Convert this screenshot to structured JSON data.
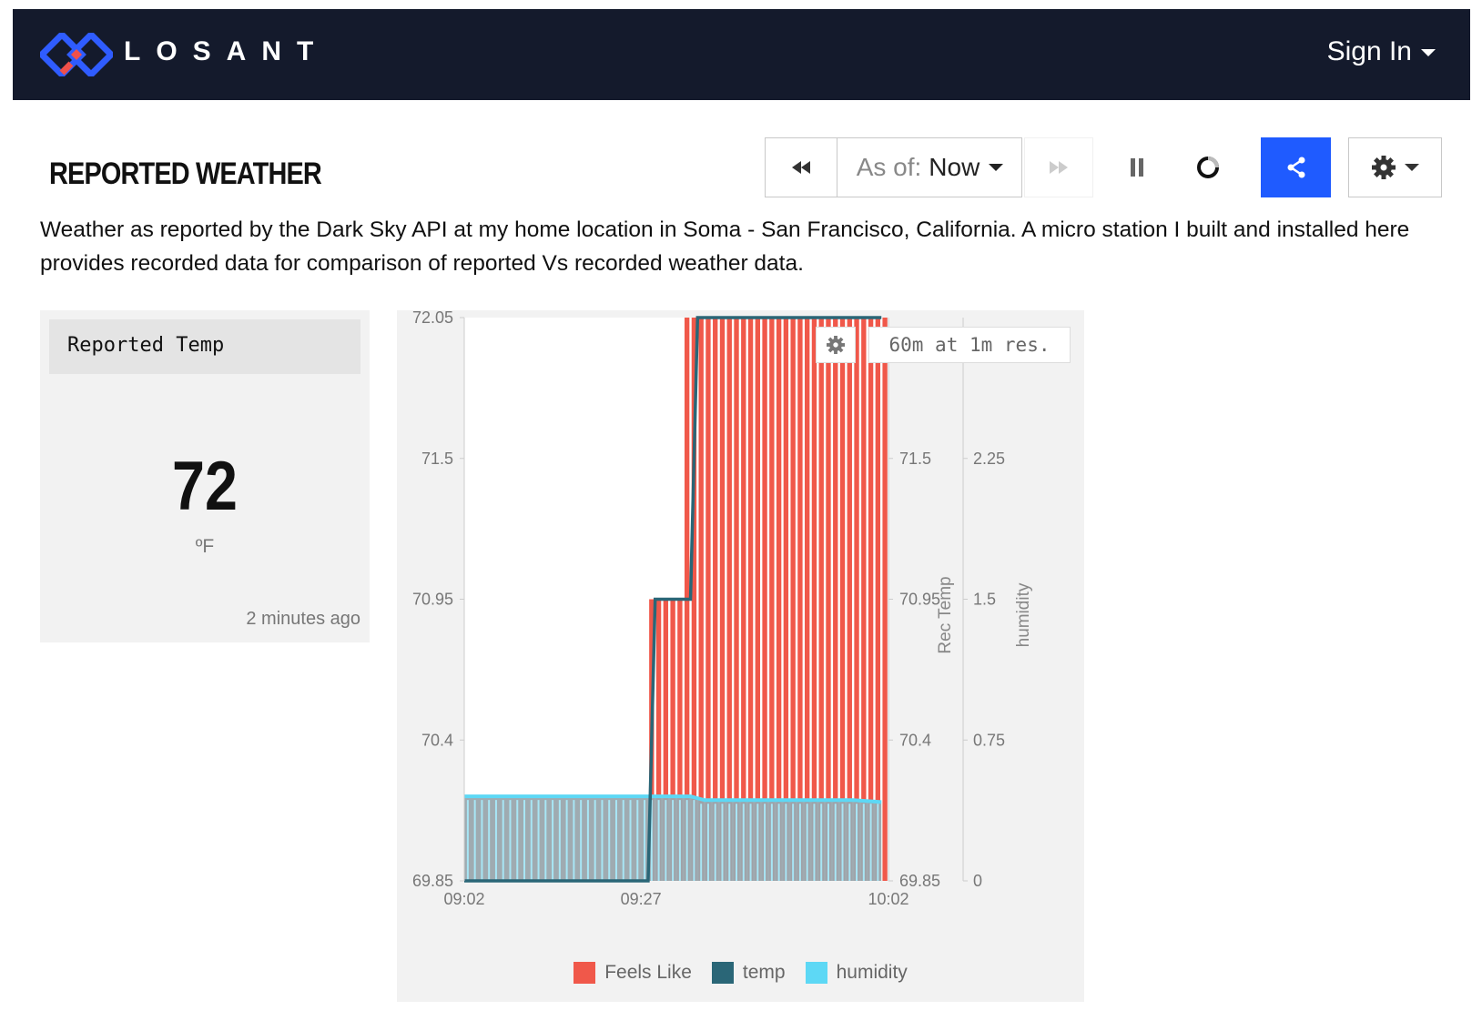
{
  "navbar": {
    "brand": "LOSANT",
    "signin_label": "Sign In",
    "colors": {
      "bg": "#141a2c",
      "logo_blue": "#2f5cff",
      "logo_red": "#f0504a"
    }
  },
  "dashboard": {
    "title": "REPORTED WEATHER",
    "description": "Weather as reported by the Dark Sky API at my home location in Soma - San Francisco, California. A micro station I built and installed here provides recorded data for comparison of reported Vs recorded weather data."
  },
  "toolbar": {
    "prev_icon": "rewind-icon",
    "asof_label": "As of:",
    "asof_value": "Now",
    "next_icon": "fast-forward-icon",
    "pause_icon": "pause-icon",
    "spinner_icon": "loading-spinner-icon",
    "share_icon": "share-icon",
    "settings_icon": "gear-icon",
    "share_color": "#1f5bff"
  },
  "indicator": {
    "header": "Reported Temp",
    "value": "72",
    "unit": "ºF",
    "updated": "2 minutes ago"
  },
  "chart_overlay": {
    "settings_icon": "gear-icon",
    "resolution_label": "60m at 1m res."
  },
  "chart_data": {
    "type": "bar",
    "x_tick_labels": [
      "09:02",
      "09:27",
      "10:02"
    ],
    "x_range_minutes": [
      0,
      60
    ],
    "y_left": {
      "ticks": [
        "72.05",
        "71.5",
        "70.95",
        "70.4",
        "69.85"
      ],
      "range": [
        69.85,
        72.05
      ]
    },
    "y_right_1": {
      "title": "Rec Temp",
      "ticks": [
        "71.5",
        "70.95",
        "70.4",
        "69.85"
      ],
      "range": [
        69.85,
        72.05
      ]
    },
    "y_right_2": {
      "title": "humidity",
      "ticks": [
        "2.25",
        "1.5",
        "0.75",
        "0"
      ],
      "range": [
        0,
        3
      ]
    },
    "series": [
      {
        "name": "Feels Like",
        "kind": "bar",
        "color": "#f0584a",
        "axis": "y_left",
        "values": [
          69.85,
          69.85,
          69.85,
          69.85,
          69.85,
          69.85,
          69.85,
          69.85,
          69.85,
          69.85,
          69.85,
          69.85,
          69.85,
          69.85,
          69.85,
          69.85,
          69.85,
          69.85,
          69.85,
          69.85,
          69.85,
          69.85,
          69.85,
          69.85,
          69.85,
          69.85,
          70.95,
          70.95,
          70.95,
          70.95,
          70.95,
          72.05,
          72.05,
          72.05,
          72.05,
          72.05,
          72.05,
          72.05,
          72.05,
          72.05,
          72.05,
          72.05,
          72.05,
          72.05,
          72.05,
          72.05,
          72.05,
          72.05,
          72.05,
          72.05,
          72.05,
          72.05,
          72.05,
          72.05,
          72.05,
          72.05,
          72.05,
          72.05,
          72.05,
          72.05
        ]
      },
      {
        "name": "temp",
        "kind": "line",
        "color": "#2a6677",
        "axis": "y_right_1",
        "points": [
          [
            0,
            69.85
          ],
          [
            26,
            69.85
          ],
          [
            27,
            70.95
          ],
          [
            32,
            70.95
          ],
          [
            33,
            72.05
          ],
          [
            59,
            72.05
          ]
        ]
      },
      {
        "name": "humidity",
        "kind": "area",
        "color": "#5dd8f5",
        "axis": "y_right_2",
        "points": [
          [
            0,
            0.45
          ],
          [
            26,
            0.45
          ],
          [
            32,
            0.45
          ],
          [
            34,
            0.43
          ],
          [
            55,
            0.43
          ],
          [
            59,
            0.42
          ]
        ]
      }
    ],
    "legend_position": "bottom-center",
    "grid": false
  }
}
